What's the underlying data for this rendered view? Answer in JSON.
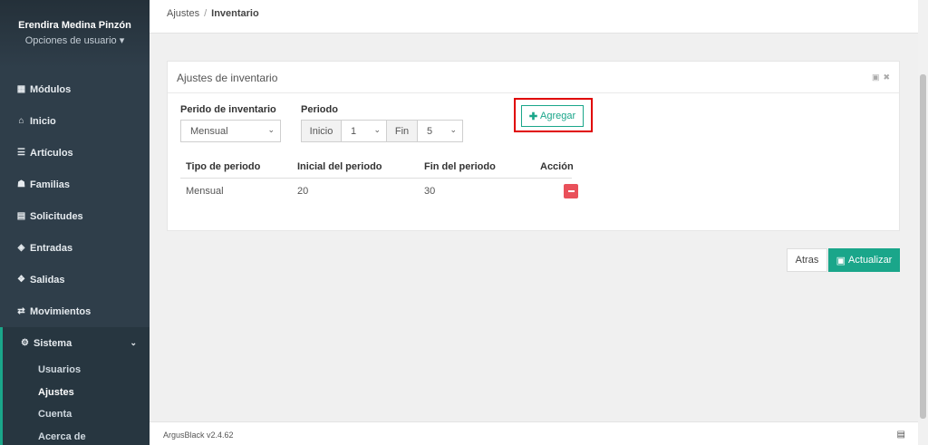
{
  "sidebar": {
    "user_name": "Erendira Medina Pinzón",
    "user_options": "Opciones de usuario",
    "items": [
      {
        "label": "Módulos",
        "icon": "th-large-icon"
      },
      {
        "label": "Inicio",
        "icon": "home-icon"
      },
      {
        "label": "Artículos",
        "icon": "list-icon"
      },
      {
        "label": "Familias",
        "icon": "sitemap-icon"
      },
      {
        "label": "Solicitudes",
        "icon": "file-icon"
      },
      {
        "label": "Entradas",
        "icon": "cube-icon"
      },
      {
        "label": "Salidas",
        "icon": "dropbox-icon"
      },
      {
        "label": "Movimientos",
        "icon": "exchange-icon"
      },
      {
        "label": "Sistema",
        "icon": "cogs-icon"
      }
    ],
    "sub_items": [
      "Usuarios",
      "Ajustes",
      "Cuenta",
      "Acerca de"
    ]
  },
  "breadcrumb": {
    "parent": "Ajustes",
    "separator": "/",
    "current": "Inventario"
  },
  "panel": {
    "title": "Ajustes de inventario",
    "periodo_inventario_label": "Perido de inventario",
    "periodo_inventario_value": "Mensual",
    "periodo_label": "Periodo",
    "inicio_label": "Inicio",
    "inicio_value": "1",
    "fin_label": "Fin",
    "fin_value": "5",
    "add_button": "Agregar",
    "table": {
      "headers": [
        "Tipo de periodo",
        "Inicial del periodo",
        "Fin del periodo",
        "Acción"
      ],
      "rows": [
        [
          "Mensual",
          "20",
          "30"
        ]
      ]
    }
  },
  "actions": {
    "back": "Atras",
    "update": "Actualizar"
  },
  "footer": {
    "version": "ArgusBlack v2.4.62"
  },
  "colors": {
    "accent": "#1aa68a",
    "sidebar": "#2f3e4a",
    "danger": "#e9505a",
    "highlight": "#e00000"
  }
}
